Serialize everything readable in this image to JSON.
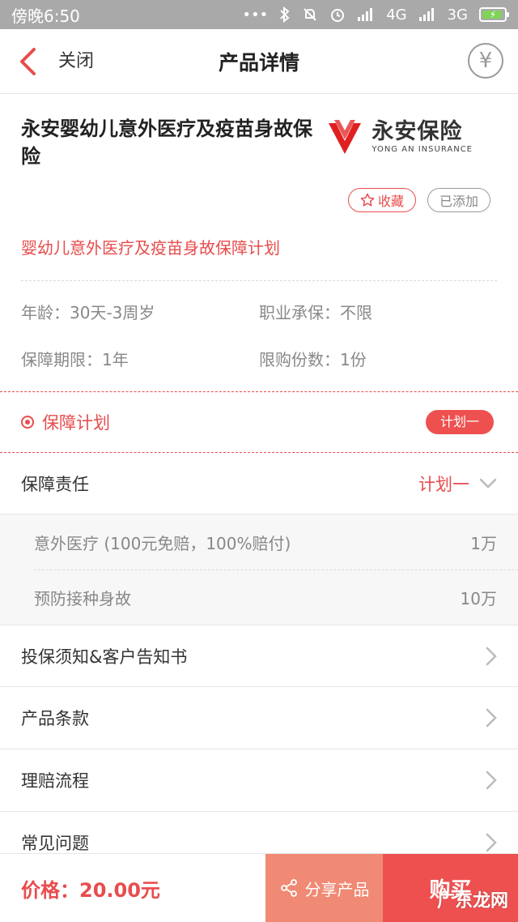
{
  "status_bar": {
    "time": "傍晚6:50",
    "network_4g": "4G",
    "network_3g": "3G"
  },
  "nav": {
    "close_label": "关闭",
    "title": "产品详情",
    "yen_symbol": "¥"
  },
  "product": {
    "title": "永安婴幼儿意外医疗及疫苗身故保险",
    "logo_cn": "永安保险",
    "logo_en": "YONG AN INSURANCE",
    "favorite_label": "收藏",
    "added_label": "已添加",
    "subtitle": "婴幼儿意外医疗及疫苗身故保障计划"
  },
  "attributes": {
    "age": "年龄：30天-3周岁",
    "occupation": "职业承保：不限",
    "period": "保障期限：1年",
    "limit": "限购份数：1份"
  },
  "plan": {
    "label": "保障计划",
    "selected": "计划一"
  },
  "coverage": {
    "label": "保障责任",
    "selected_plan": "计划一",
    "items": [
      {
        "name": "意外医疗 (100元免赔，100%赔付)",
        "amount": "1万"
      },
      {
        "name": "预防接种身故",
        "amount": "10万"
      }
    ]
  },
  "links": [
    {
      "label": "投保须知&客户告知书"
    },
    {
      "label": "产品条款"
    },
    {
      "label": "理赔流程"
    },
    {
      "label": "常见问题"
    }
  ],
  "bottom_bar": {
    "price": "价格：20.00元",
    "share_label": "分享产品",
    "buy_label": "购买"
  },
  "watermark": "广东龙网",
  "colors": {
    "accent": "#e84c4c",
    "share_bg": "#f08a74",
    "buy_bg": "#ee5050",
    "status_bar_bg": "#a9a9a9"
  }
}
